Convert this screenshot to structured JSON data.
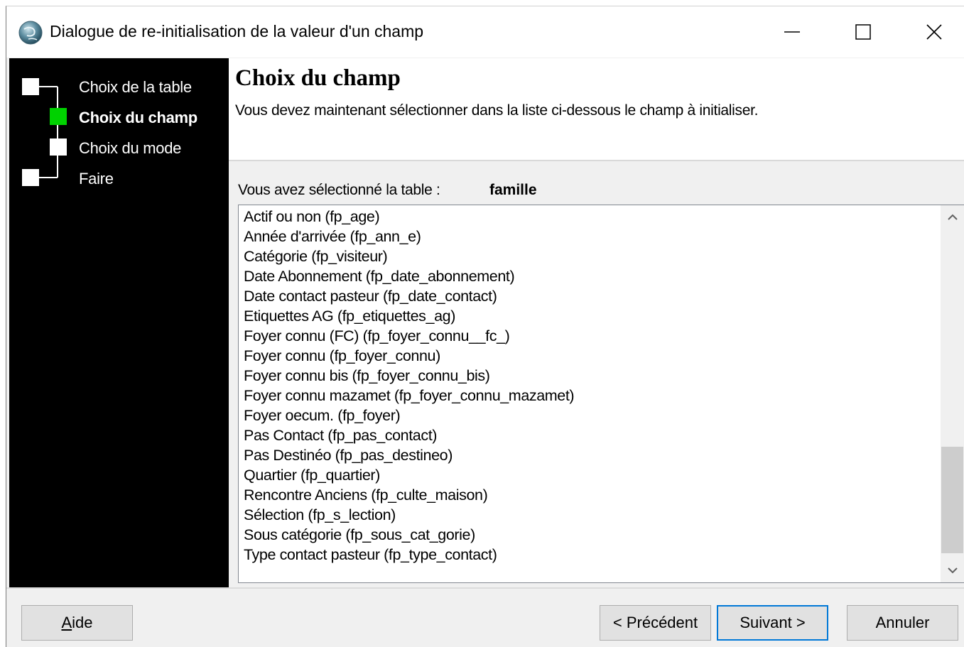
{
  "window": {
    "title": "Dialogue de re-initialisation de la valeur d'un champ"
  },
  "steps": [
    {
      "label": "Choix de la table",
      "active": false
    },
    {
      "label": "Choix du champ",
      "active": true
    },
    {
      "label": "Choix du mode",
      "active": false
    },
    {
      "label": "Faire",
      "active": false
    }
  ],
  "header": {
    "title": "Choix du champ",
    "description": "Vous devez maintenant sélectionner dans la liste ci-dessous le champ à initialiser."
  },
  "selection": {
    "label": "Vous avez sélectionné la table :",
    "table": "famille"
  },
  "fields": [
    "Actif ou non (fp_age)",
    "Année d'arrivée (fp_ann_e)",
    "Catégorie (fp_visiteur)",
    "Date Abonnement (fp_date_abonnement)",
    "Date contact pasteur (fp_date_contact)",
    "Etiquettes AG (fp_etiquettes_ag)",
    "Foyer connu (FC) (fp_foyer_connu__fc_)",
    "Foyer connu (fp_foyer_connu)",
    "Foyer connu bis (fp_foyer_connu_bis)",
    "Foyer connu mazamet (fp_foyer_connu_mazamet)",
    "Foyer oecum. (fp_foyer)",
    "Pas Contact (fp_pas_contact)",
    "Pas Destinéo (fp_pas_destineo)",
    "Quartier (fp_quartier)",
    "Rencontre Anciens (fp_culte_maison)",
    "Sélection (fp_s_lection)",
    "Sous catégorie (fp_sous_cat_gorie)",
    "Type contact pasteur (fp_type_contact)"
  ],
  "buttons": {
    "help_accel": "A",
    "help_rest": "ide",
    "prev": "< Précédent",
    "next": "Suivant >",
    "cancel": "Annuler"
  },
  "colors": {
    "active_step": "#00d200",
    "inactive_step": "#ffffff",
    "default_button_border": "#0078d7"
  },
  "icons": {
    "app": "globe-icon",
    "minimize": "minimize-icon",
    "maximize": "maximize-icon",
    "close": "close-icon"
  }
}
